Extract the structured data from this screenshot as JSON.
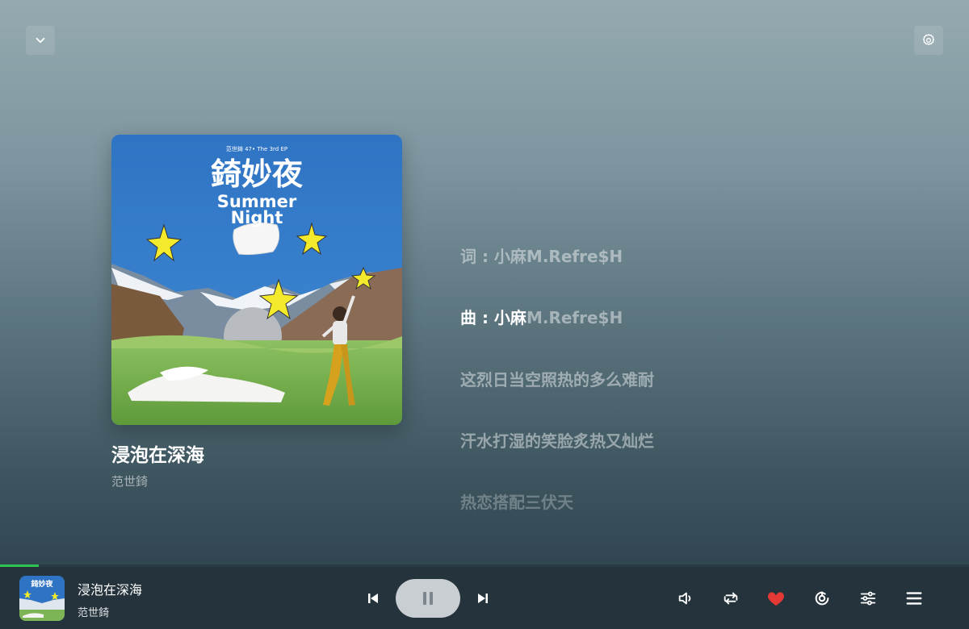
{
  "window": {
    "collapse_icon": "chevron-down-icon",
    "settings_icon": "gear-icon"
  },
  "album": {
    "cover_texts": {
      "header": "范世錡 47• The 3rd EP",
      "title_cn": "錡妙夜",
      "title_en_1": "Summer",
      "title_en_2": "Night"
    }
  },
  "song": {
    "title": "浸泡在深海",
    "artist": "范世錡"
  },
  "lyrics": {
    "line1": "词 : 小麻M.Refre$H",
    "line2_highlight": "曲 : 小麻",
    "line2_rest": "M.Refre$H",
    "line3": "这烈日当空照热的多么难耐",
    "line4": "汗水打湿的笑脸炙热又灿烂",
    "line5": "热恋搭配三伏天"
  },
  "player": {
    "title": "浸泡在深海",
    "artist": "范世錡",
    "progress_fraction": 0.04,
    "accent_color": "#2ec44f",
    "liked": true,
    "like_color": "#e53935",
    "controls": [
      "previous-icon",
      "pause-icon",
      "next-icon",
      "volume-icon",
      "repeat-icon",
      "heart-icon",
      "heartbeat-mode-icon",
      "equalizer-icon",
      "playlist-icon"
    ]
  }
}
